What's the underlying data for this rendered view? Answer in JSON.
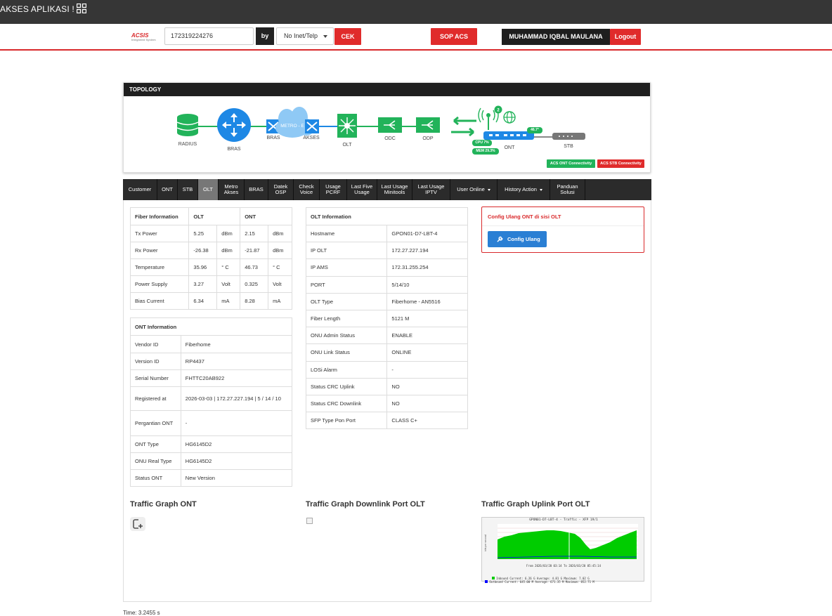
{
  "app": {
    "title": "AKSES APLIKASI !"
  },
  "search": {
    "logo": "ACSIS",
    "logo_sub": "Integrated System",
    "query_value": "172319224276",
    "by_label": "by",
    "by_option": "No Inet/Telp",
    "cek_label": "CEK",
    "sop_label": "SOP ACS",
    "user_name": "MUHAMMAD IQBAL MAULANA",
    "logout_label": "Logout"
  },
  "topology": {
    "title": "TOPOLOGY",
    "labels": {
      "radius": "RADIUS",
      "bras": "BRAS",
      "bras2": "BRAS",
      "metro": "METRO - E",
      "akses": "AKSES",
      "olt": "OLT",
      "odc": "ODC",
      "odp": "ODP",
      "ont": "ONT",
      "stb": "STB",
      "cpu": "CPU 7%",
      "mem": "MEM 29.3%",
      "temp": "46.7°",
      "wifi_count": "2"
    },
    "acs_ont": "ACS ONT Connectivity",
    "acs_stb": "ACS STB Connectivity",
    "colors": {
      "green": "#22b35a",
      "blue": "#1e88e5",
      "red": "#e02b2b"
    }
  },
  "tabs": [
    {
      "label": "Customer"
    },
    {
      "label": "ONT"
    },
    {
      "label": "STB"
    },
    {
      "label": "OLT",
      "active": true
    },
    {
      "label": "Metro Akses"
    },
    {
      "label": "BRAS"
    },
    {
      "label": "Datek OSP"
    },
    {
      "label": "Check Voice"
    },
    {
      "label": "Usage PCRF"
    },
    {
      "label": "Last Five Usage"
    },
    {
      "label": "Last Usage Minitools"
    },
    {
      "label": "Last Usage IPTV"
    },
    {
      "label": "User Online",
      "dropdown": true
    },
    {
      "label": "History Action",
      "dropdown": true
    },
    {
      "label": "Panduan Solusi"
    }
  ],
  "fiber": {
    "headers": [
      "Fiber Information",
      "OLT",
      "ONT"
    ],
    "rows": [
      [
        "Tx Power",
        "5.25",
        "dBm",
        "2.15",
        "dBm"
      ],
      [
        "Rx Power",
        "-26.38",
        "dBm",
        "-21.87",
        "dBm"
      ],
      [
        "Temperature",
        "35.96",
        "° C",
        "46.73",
        "° C"
      ],
      [
        "Power Supply",
        "3.27",
        "Volt",
        "0.325",
        "Volt"
      ],
      [
        "Bias Current",
        "6.34",
        "mA",
        "8.28",
        "mA"
      ]
    ]
  },
  "ont_info": {
    "title": "ONT Information",
    "rows": [
      [
        "Vendor ID",
        "Fiberhome"
      ],
      [
        "Version ID",
        "RP4437"
      ],
      [
        "Serial Number",
        "FHTTC20AB922"
      ],
      [
        "Registered at",
        "2026-03-03 | 172.27.227.194 | 5 / 14 / 10"
      ],
      [
        "Pergantian ONT",
        "-"
      ],
      [
        "ONT Type",
        "HG6145D2"
      ],
      [
        "ONU Real Type",
        "HG6145D2"
      ],
      [
        "Status ONT",
        "New Version"
      ]
    ]
  },
  "olt_info": {
    "title": "OLT Information",
    "rows": [
      [
        "Hostname",
        "GPON01-D7-LBT-4"
      ],
      [
        "IP OLT",
        "172.27.227.194"
      ],
      [
        "IP AMS",
        "172.31.255.254"
      ],
      [
        "PORT",
        "5/14/10"
      ],
      [
        "OLT Type",
        "Fiberhome - AN5516"
      ],
      [
        "Fiber Length",
        "5121 M"
      ],
      [
        "ONU Admin Status",
        "ENABLE"
      ],
      [
        "ONU Link Status",
        "ONLINE"
      ],
      [
        "LOSi Alarm",
        "-"
      ],
      [
        "Status CRC Uplink",
        "NO"
      ],
      [
        "Status CRC Downlink",
        "NO"
      ],
      [
        "SFP Type Pon Port",
        "CLASS C+"
      ]
    ]
  },
  "config": {
    "title": "Config Ulang ONT di sisi OLT",
    "button": "Config Ulang"
  },
  "graphs": {
    "ont": "Traffic Graph ONT",
    "downlink": "Traffic Graph Downlink Port OLT",
    "uplink": "Traffic Graph Uplink Port OLT",
    "uplink_title": "GPON01-D7-LBT-4 - Traffic - XFP 19/1",
    "uplink_footer": "From 2026/03/20 03:14 To 2026/03/20 05:45:14",
    "legend": [
      [
        "Inbound",
        "Current:",
        "6.26 G",
        "Average:",
        "4.81 G",
        "Maximum:",
        "7.02 G"
      ],
      [
        "Outbound",
        "Current:",
        "645.00 M",
        "Average:",
        "671.35 M",
        "Maximum:",
        "852.71 M"
      ]
    ]
  },
  "time": "Time: 3.2455 s"
}
